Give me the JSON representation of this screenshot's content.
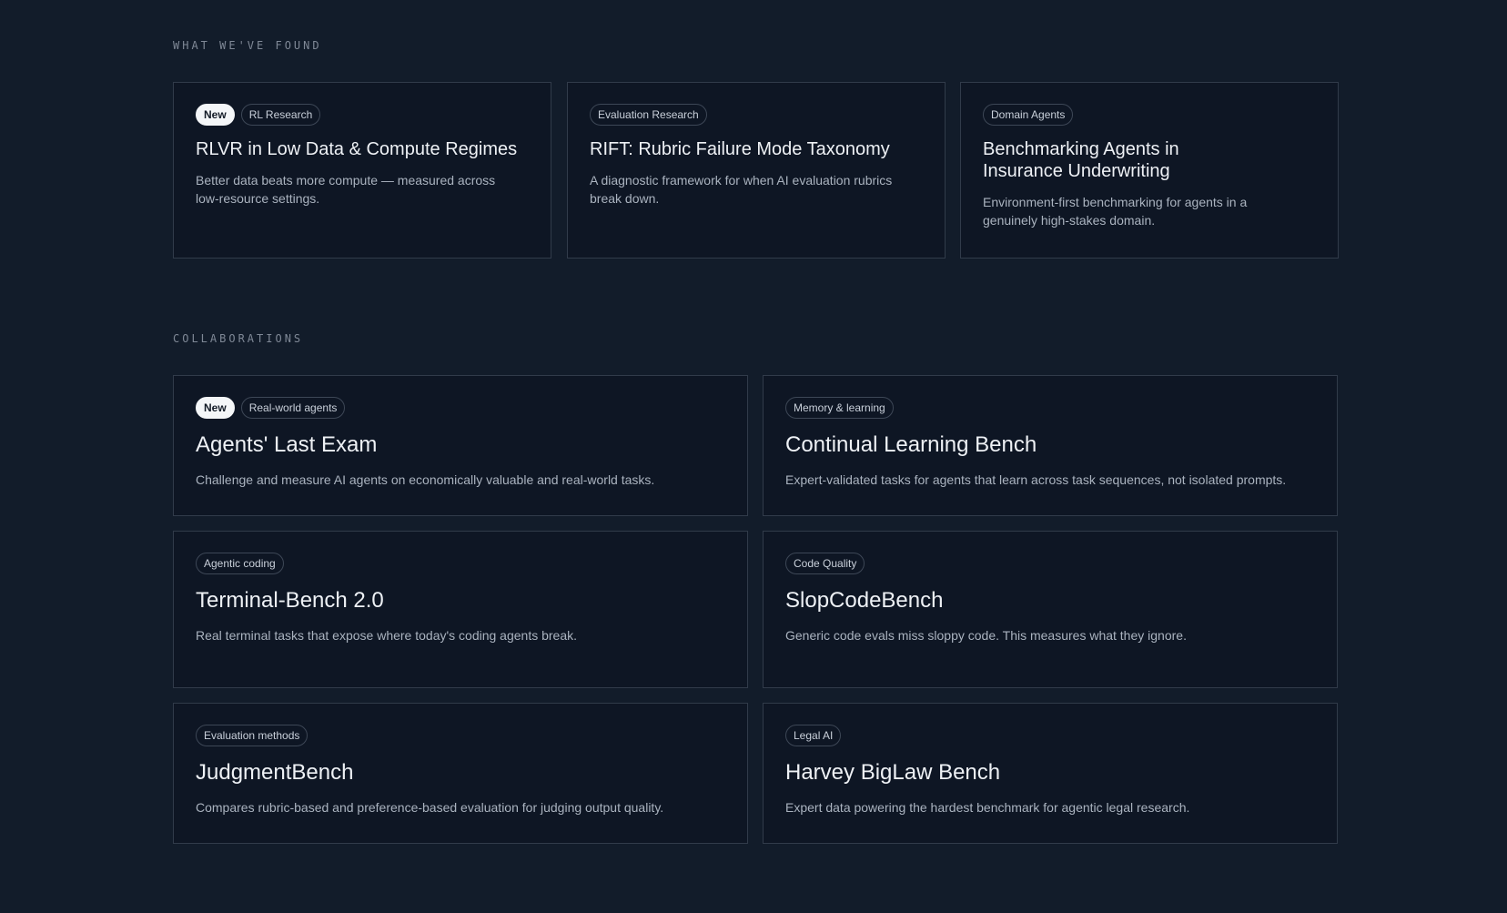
{
  "found": {
    "label": "WHAT WE'VE FOUND",
    "cards": [
      {
        "tags": [
          "New",
          "RL Research"
        ],
        "title": "RLVR in Low Data & Compute Regimes",
        "description": "Better data beats more compute — measured across low-resource settings."
      },
      {
        "tags": [
          "Evaluation Research"
        ],
        "title": "RIFT: Rubric Failure Mode Taxonomy",
        "description": "A diagnostic framework for when AI evaluation rubrics break down."
      },
      {
        "tags": [
          "Domain Agents"
        ],
        "title": "Benchmarking Agents in Insurance Underwriting",
        "description": "Environment-first benchmarking for agents in a genuinely high-stakes domain."
      }
    ]
  },
  "collaborations": {
    "label": "COLLABORATIONS",
    "cards": [
      {
        "tags": [
          "New",
          "Real-world agents"
        ],
        "title": "Agents' Last Exam",
        "description": "Challenge and measure AI agents on economically valuable and real-world tasks."
      },
      {
        "tags": [
          "Memory & learning"
        ],
        "title": "Continual Learning Bench",
        "description": "Expert-validated tasks for agents that learn across task sequences, not isolated prompts."
      },
      {
        "tags": [
          "Agentic coding"
        ],
        "title": "Terminal-Bench 2.0",
        "description": "Real terminal tasks that expose where today's coding agents break."
      },
      {
        "tags": [
          "Code Quality"
        ],
        "title": "SlopCodeBench",
        "description": "Generic code evals miss sloppy code. This measures what they ignore."
      },
      {
        "tags": [
          "Evaluation methods"
        ],
        "title": "JudgmentBench",
        "description": "Compares rubric-based and preference-based evaluation for judging output quality."
      },
      {
        "tags": [
          "Legal AI"
        ],
        "title": "Harvey BigLaw Bench",
        "description": "Expert data powering the hardest benchmark for agentic legal research."
      }
    ]
  },
  "colors": {
    "background": "#121c2a",
    "card_background": "#0e1624",
    "card_border": "#313b4a",
    "new_badge": "#f4f6f8"
  }
}
